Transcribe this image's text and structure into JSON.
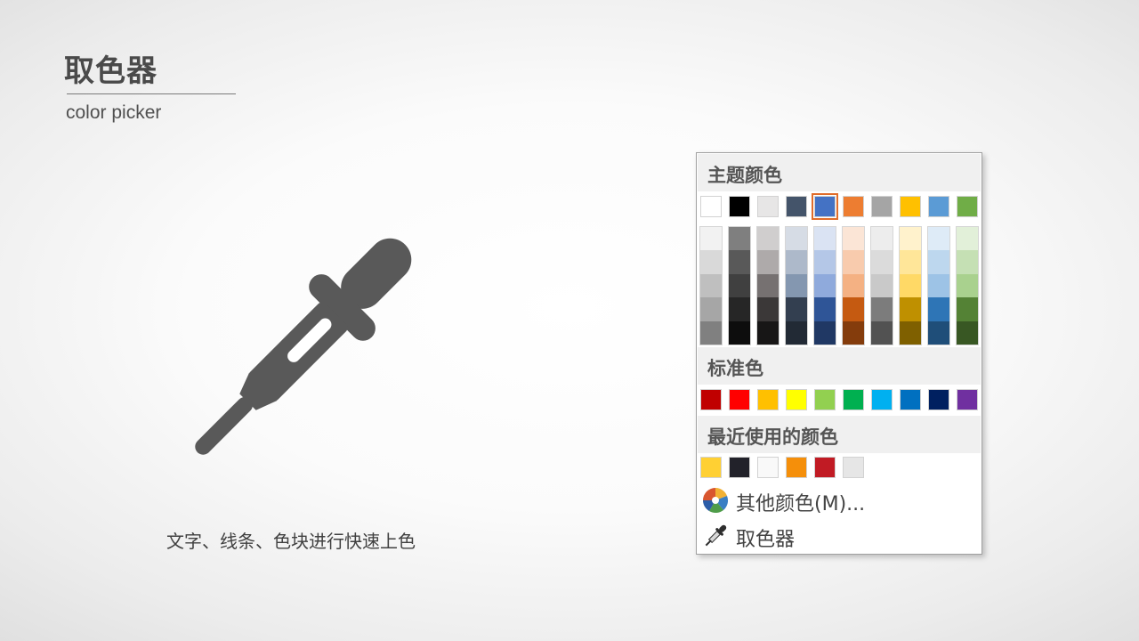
{
  "slide": {
    "title": "取色器",
    "subtitle": "color picker",
    "caption": "文字、线条、色块进行快速上色"
  },
  "menu": {
    "theme_header": "主题颜色",
    "standard_header": "标准色",
    "recent_header": "最近使用的颜色",
    "more_colors_label": "其他颜色(M)...",
    "eyedropper_label": "取色器",
    "theme_colors": [
      "#FFFFFF",
      "#000000",
      "#E7E6E6",
      "#44546A",
      "#4472C4",
      "#ED7D31",
      "#A5A5A5",
      "#FFC000",
      "#5B9BD5",
      "#70AD47"
    ],
    "selected_theme_index": 4,
    "theme_shades": [
      [
        "#F2F2F2",
        "#D9D9D9",
        "#BFBFBF",
        "#A6A6A6",
        "#808080"
      ],
      [
        "#7F7F7F",
        "#595959",
        "#404040",
        "#262626",
        "#0D0D0D"
      ],
      [
        "#D0CECE",
        "#AEAAAA",
        "#767171",
        "#3B3838",
        "#171616"
      ],
      [
        "#D6DCE5",
        "#ADB9CA",
        "#8497B0",
        "#333F50",
        "#222A35"
      ],
      [
        "#DAE3F3",
        "#B4C7E7",
        "#8FAADC",
        "#2F5597",
        "#203864"
      ],
      [
        "#FBE5D6",
        "#F8CBAD",
        "#F4B183",
        "#C55A11",
        "#843C0C"
      ],
      [
        "#EDEDED",
        "#DBDBDB",
        "#C9C9C9",
        "#7C7C7C",
        "#525252"
      ],
      [
        "#FFF2CC",
        "#FFE699",
        "#FFD966",
        "#BF9000",
        "#7F6000"
      ],
      [
        "#DEEBF7",
        "#BDD7EE",
        "#9DC3E6",
        "#2E75B6",
        "#1F4E79"
      ],
      [
        "#E2F0D9",
        "#C5E0B4",
        "#A9D18E",
        "#548235",
        "#385723"
      ]
    ],
    "standard_colors": [
      "#C00000",
      "#FF0000",
      "#FFC000",
      "#FFFF00",
      "#92D050",
      "#00B050",
      "#00B0F0",
      "#0070C0",
      "#002060",
      "#7030A0"
    ],
    "recent_colors": [
      "#FFD033",
      "#22222A",
      "#F9F9F9",
      "#F58F0A",
      "#C11B24",
      "#E6E6E6"
    ]
  }
}
